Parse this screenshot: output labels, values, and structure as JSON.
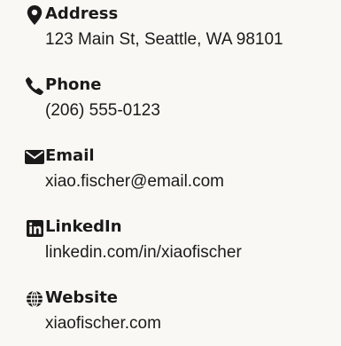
{
  "contact": {
    "items": [
      {
        "icon": "map-pin-icon",
        "label": "Address",
        "value": "123 Main St, Seattle, WA 98101"
      },
      {
        "icon": "phone-icon",
        "label": "Phone",
        "value": "(206) 555-0123"
      },
      {
        "icon": "envelope-icon",
        "label": "Email",
        "value": "xiao.fischer@email.com"
      },
      {
        "icon": "linkedin-icon",
        "label": "LinkedIn",
        "value": "linkedin.com/in/xiaofischer"
      },
      {
        "icon": "globe-icon",
        "label": "Website",
        "value": "xiaofischer.com"
      }
    ]
  },
  "colors": {
    "text": "#1a1a1a",
    "background": "#faf8f4"
  }
}
